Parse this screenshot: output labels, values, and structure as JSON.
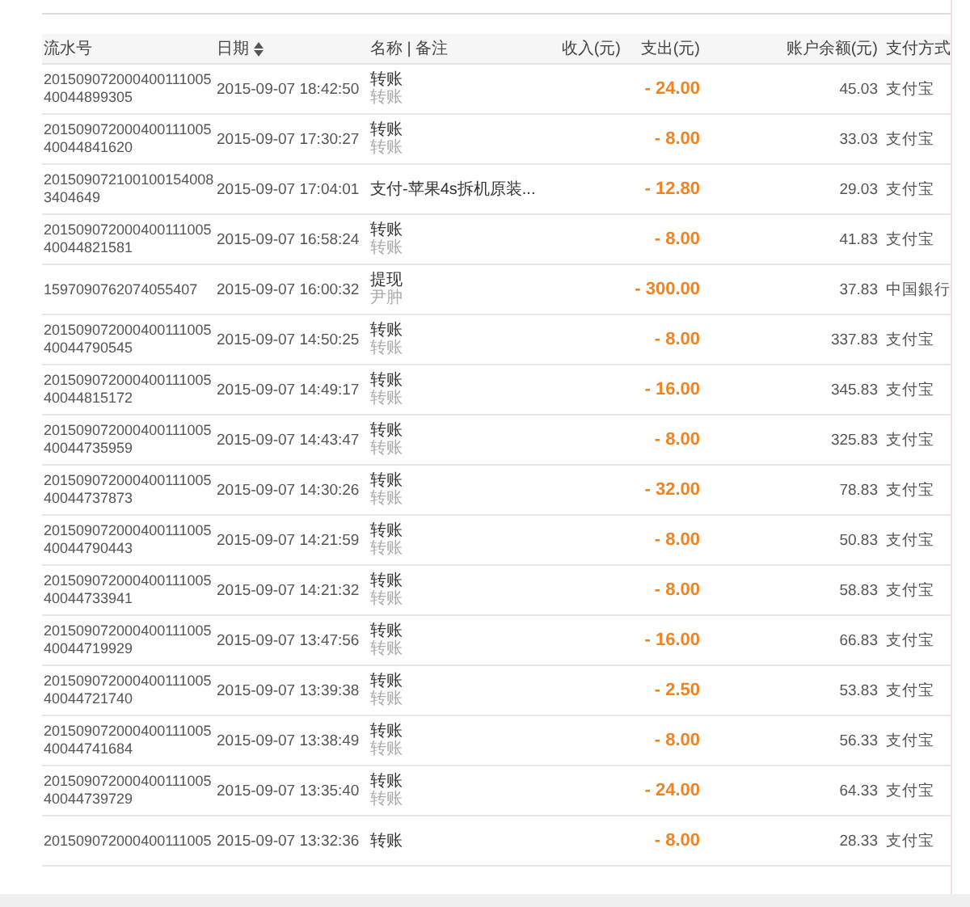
{
  "table": {
    "columns": [
      {
        "label": "流水号",
        "sortable": false
      },
      {
        "label": "日期",
        "sortable": true
      },
      {
        "label": "名称 | 备注",
        "sortable": false
      },
      {
        "label": "收入(元)",
        "sortable": false
      },
      {
        "label": "支出(元)",
        "sortable": false
      },
      {
        "label": "账户余额(元)",
        "sortable": false
      },
      {
        "label": "支付方式",
        "sortable": false
      }
    ],
    "rows": [
      {
        "serial": "20150907200040011100540044899305",
        "date": "2015-09-07 18:42:50",
        "name": "转账",
        "note": "转账",
        "expense": "- 24.00",
        "balance": "45.03",
        "method": "支付宝"
      },
      {
        "serial": "20150907200040011100540044841620",
        "date": "2015-09-07 17:30:27",
        "name": "转账",
        "note": "转账",
        "expense": "- 8.00",
        "balance": "33.03",
        "method": "支付宝"
      },
      {
        "serial": "2015090721001001540083404649",
        "date": "2015-09-07 17:04:01",
        "name": "支付-苹果4s拆机原装...",
        "expense": "- 12.80",
        "balance": "29.03",
        "method": "支付宝"
      },
      {
        "serial": "20150907200040011100540044821581",
        "date": "2015-09-07 16:58:24",
        "name": "转账",
        "note": "转账",
        "expense": "- 8.00",
        "balance": "41.83",
        "method": "支付宝"
      },
      {
        "serial": "1597090762074055407",
        "date": "2015-09-07 16:00:32",
        "name": "提现",
        "note": "尹肿",
        "expense": "- 300.00",
        "balance": "37.83",
        "method": "中国銀行"
      },
      {
        "serial": "20150907200040011100540044790545",
        "date": "2015-09-07 14:50:25",
        "name": "转账",
        "note": "转账",
        "expense": "- 8.00",
        "balance": "337.83",
        "method": "支付宝"
      },
      {
        "serial": "20150907200040011100540044815172",
        "date": "2015-09-07 14:49:17",
        "name": "转账",
        "note": "转账",
        "expense": "- 16.00",
        "balance": "345.83",
        "method": "支付宝"
      },
      {
        "serial": "20150907200040011100540044735959",
        "date": "2015-09-07 14:43:47",
        "name": "转账",
        "note": "转账",
        "expense": "- 8.00",
        "balance": "325.83",
        "method": "支付宝"
      },
      {
        "serial": "20150907200040011100540044737873",
        "date": "2015-09-07 14:30:26",
        "name": "转账",
        "note": "转账",
        "expense": "- 32.00",
        "balance": "78.83",
        "method": "支付宝"
      },
      {
        "serial": "20150907200040011100540044790443",
        "date": "2015-09-07 14:21:59",
        "name": "转账",
        "note": "转账",
        "expense": "- 8.00",
        "balance": "50.83",
        "method": "支付宝"
      },
      {
        "serial": "20150907200040011100540044733941",
        "date": "2015-09-07 14:21:32",
        "name": "转账",
        "note": "转账",
        "expense": "- 8.00",
        "balance": "58.83",
        "method": "支付宝"
      },
      {
        "serial": "20150907200040011100540044719929",
        "date": "2015-09-07 13:47:56",
        "name": "转账",
        "note": "转账",
        "expense": "- 16.00",
        "balance": "66.83",
        "method": "支付宝"
      },
      {
        "serial": "20150907200040011100540044721740",
        "date": "2015-09-07 13:39:38",
        "name": "转账",
        "note": "转账",
        "expense": "- 2.50",
        "balance": "53.83",
        "method": "支付宝"
      },
      {
        "serial": "20150907200040011100540044741684",
        "date": "2015-09-07 13:38:49",
        "name": "转账",
        "note": "转账",
        "expense": "- 8.00",
        "balance": "56.33",
        "method": "支付宝"
      },
      {
        "serial": "20150907200040011100540044739729",
        "date": "2015-09-07 13:35:40",
        "name": "转账",
        "note": "转账",
        "expense": "- 24.00",
        "balance": "64.33",
        "method": "支付宝"
      },
      {
        "serial": "201509072000400111005",
        "date": "2015-09-07 13:32:36",
        "name": "转账",
        "expense": "- 8.00",
        "balance": "28.33",
        "method": "支付宝"
      }
    ]
  }
}
